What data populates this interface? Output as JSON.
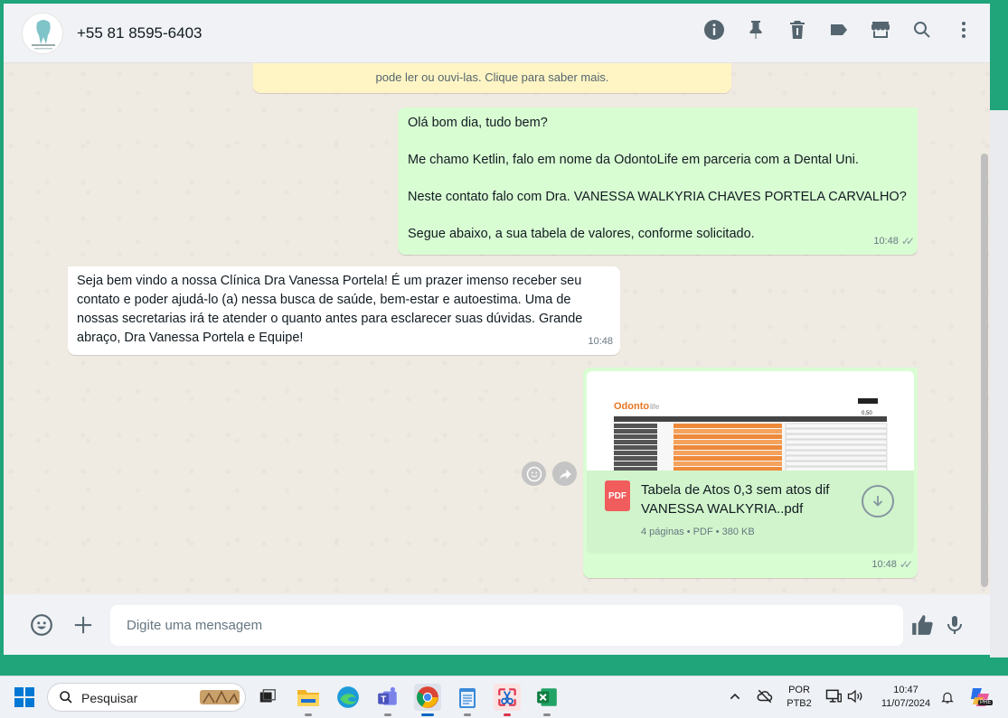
{
  "header": {
    "contact": "+55 81 8595-6403",
    "icons": [
      "info-icon",
      "pin-icon",
      "delete-icon",
      "label-icon",
      "store-icon",
      "search-icon",
      "menu-icon"
    ]
  },
  "notice": "pode ler ou ouvi-las. Clique para saber mais.",
  "messages": {
    "m1": {
      "lines": [
        "Olá bom dia, tudo bem?",
        "Me chamo Ketlin, falo em nome da OdontoLife em parceria com a Dental Uni.",
        "Neste contato falo com Dra. VANESSA WALKYRIA CHAVES PORTELA CARVALHO?",
        "Segue abaixo, a sua tabela de valores, conforme solicitado."
      ],
      "time": "10:48"
    },
    "m2": {
      "text": "Seja bem vindo a nossa Clínica Dra Vanessa Portela!  É um prazer imenso receber seu contato e poder ajudá-lo (a) nessa busca de saúde, bem-estar e autoestima. Uma de nossas secretarias irá te atender o quanto antes para esclarecer suas dúvidas. Grande abraço, Dra Vanessa Portela e Equipe!",
      "time": "10:48"
    },
    "m3": {
      "file_name": "Tabela de Atos 0,3 sem atos dif VANESSA WALKYRIA..pdf",
      "file_meta": "4 páginas • PDF • 380 KB",
      "file_type": "PDF",
      "preview_value": "0,50",
      "time": "10:48"
    }
  },
  "composer": {
    "placeholder": "Digite uma mensagem"
  },
  "taskbar": {
    "search_label": "Pesquisar",
    "lang_top": "POR",
    "lang_bottom": "PTB2",
    "time": "10:47",
    "date": "11/07/2024",
    "copilot_badge": "PRE"
  },
  "colors": {
    "outgoing": "#d9fdd3",
    "incoming": "#ffffff",
    "notice": "#fff5c4",
    "accent": "#20a57a"
  }
}
